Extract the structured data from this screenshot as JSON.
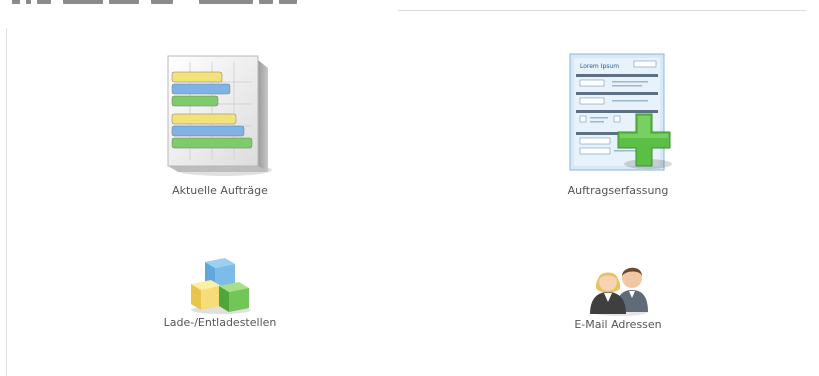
{
  "tiles": {
    "orders": {
      "label": "Aktuelle Aufträge"
    },
    "capture": {
      "label": "Auftragserfassung",
      "form_title": "Lorem Ipsum"
    },
    "loading": {
      "label": "Lade-/Entladestellen"
    },
    "email": {
      "label": "E-Mail Adressen"
    }
  },
  "colors": {
    "label_text": "#555555",
    "bar_yellow": "#f2e27a",
    "bar_blue": "#7fb2e5",
    "bar_green": "#7ecb6a",
    "plus_green": "#5cbf45"
  },
  "icons": {
    "orders": "bar-chart-icon",
    "capture": "form-add-icon",
    "loading": "cubes-icon",
    "email": "contacts-icon"
  }
}
